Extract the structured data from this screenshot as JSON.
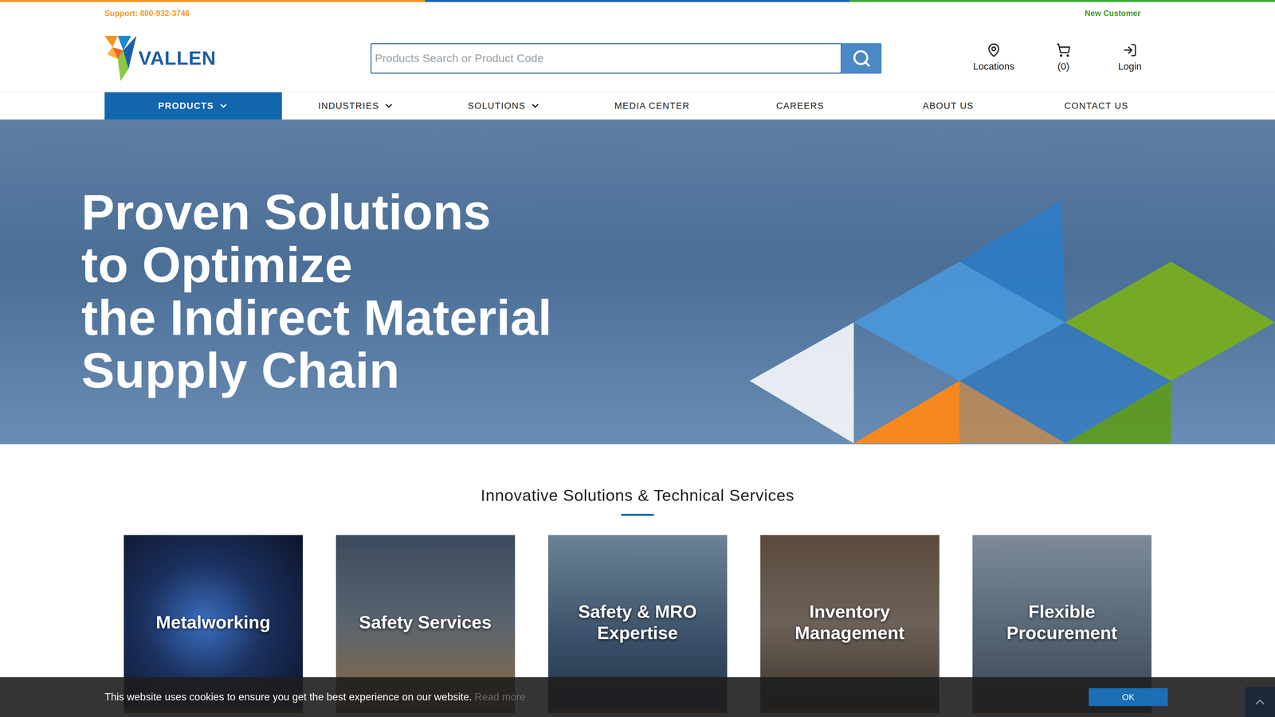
{
  "topBar": {
    "support": "Support: 800-932-3746",
    "newCustomer": "New Customer"
  },
  "logo": {
    "text": "VALLEN"
  },
  "search": {
    "placeholder": "Products Search or Product Code"
  },
  "headerLinks": [
    {
      "label": "Locations",
      "kind": "locations"
    },
    {
      "label": "(0)",
      "kind": "cart"
    },
    {
      "label": "Login",
      "kind": "login"
    }
  ],
  "nav": [
    {
      "label": "PRODUCTS",
      "dropdown": true,
      "selected": true
    },
    {
      "label": "INDUSTRIES",
      "dropdown": true,
      "selected": false
    },
    {
      "label": "SOLUTIONS",
      "dropdown": true,
      "selected": false
    },
    {
      "label": "MEDIA CENTER",
      "dropdown": false,
      "selected": false
    },
    {
      "label": "CAREERS",
      "dropdown": false,
      "selected": false
    },
    {
      "label": "ABOUT US",
      "dropdown": false,
      "selected": false
    },
    {
      "label": "CONTACT US",
      "dropdown": false,
      "selected": false
    }
  ],
  "hero": {
    "lines": [
      "Proven Solutions",
      "to Optimize",
      "the Indirect Material",
      "Supply Chain"
    ]
  },
  "section": {
    "title": "Innovative Solutions & Technical Services"
  },
  "cards": [
    {
      "lines": [
        "Metalworking"
      ]
    },
    {
      "lines": [
        "Safety Services"
      ]
    },
    {
      "lines": [
        "Safety & MRO",
        "Expertise"
      ]
    },
    {
      "lines": [
        "Inventory",
        "Management"
      ]
    },
    {
      "lines": [
        "Flexible",
        "Procurement"
      ]
    }
  ],
  "cookie": {
    "text": "This website uses cookies to ensure you get the best experience on our website.",
    "readMore": "Read more",
    "button": "OK"
  }
}
